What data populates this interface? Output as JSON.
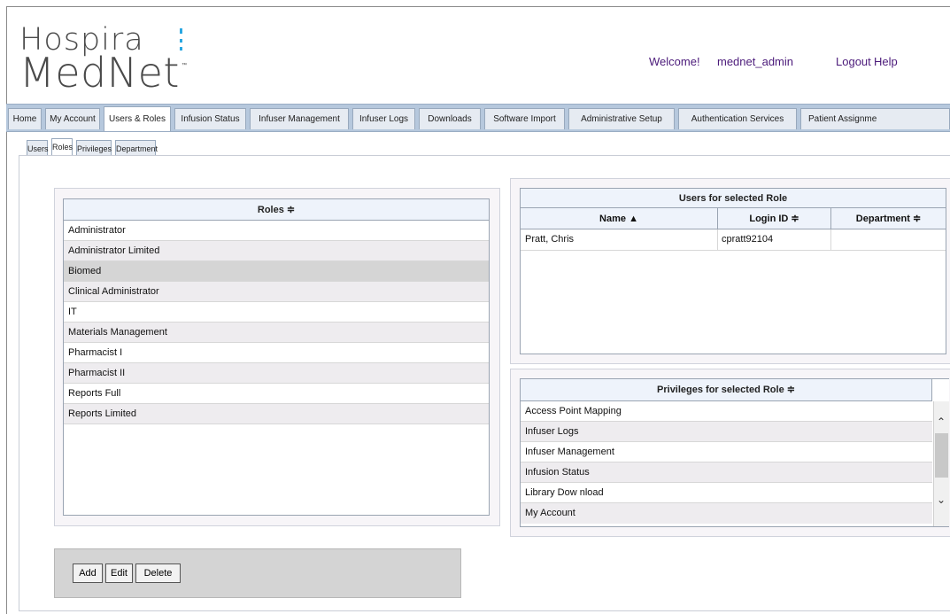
{
  "brand": {
    "line1": "Hospira",
    "line2": "MedNet",
    "tm": "™"
  },
  "header": {
    "welcome": "Welcome!",
    "username": "mednet_admin",
    "logout": "Logout",
    "help": "Help"
  },
  "main_tabs": [
    "Home",
    "My Account",
    "Users & Roles",
    "Infusion Status",
    "Infuser Management",
    "Infuser Logs",
    "Downloads",
    "Software Import",
    "Administrative Setup",
    "Authentication Services",
    "Patient Assignme"
  ],
  "active_main_tab": "Users & Roles",
  "sub_tabs": [
    "Users",
    "Roles",
    "Privileges",
    "Department"
  ],
  "active_sub_tab": "Roles",
  "roles_table": {
    "header": "Roles ≑",
    "rows": [
      "Administrator",
      "Administrator Limited",
      "Biomed",
      "Clinical Administrator",
      "IT",
      "Materials Management",
      "Pharmacist I",
      "Pharmacist II",
      "Reports Full",
      "Reports Limited"
    ],
    "selected": "Biomed"
  },
  "users_table": {
    "title": "Users for selected Role",
    "columns": [
      "Name ▲",
      "Login ID ≑",
      "Department ≑"
    ],
    "rows": [
      {
        "name": "Pratt, Chris",
        "login_id": "cpratt92104",
        "department": ""
      }
    ]
  },
  "privileges_table": {
    "header": "Privileges for selected Role ≑",
    "rows": [
      "Access Point Mapping",
      "Infuser Logs",
      "Infuser Management",
      "Infusion Status",
      "Library Dow nload",
      "My Account"
    ]
  },
  "buttons": {
    "add": "Add",
    "edit": "Edit",
    "delete": "Delete"
  },
  "colors": {
    "brand_blue": "#2aa7e1",
    "link_purple": "#4b1a7a",
    "tabbar": "#b6c8dd",
    "header_row": "#eef3fb"
  }
}
